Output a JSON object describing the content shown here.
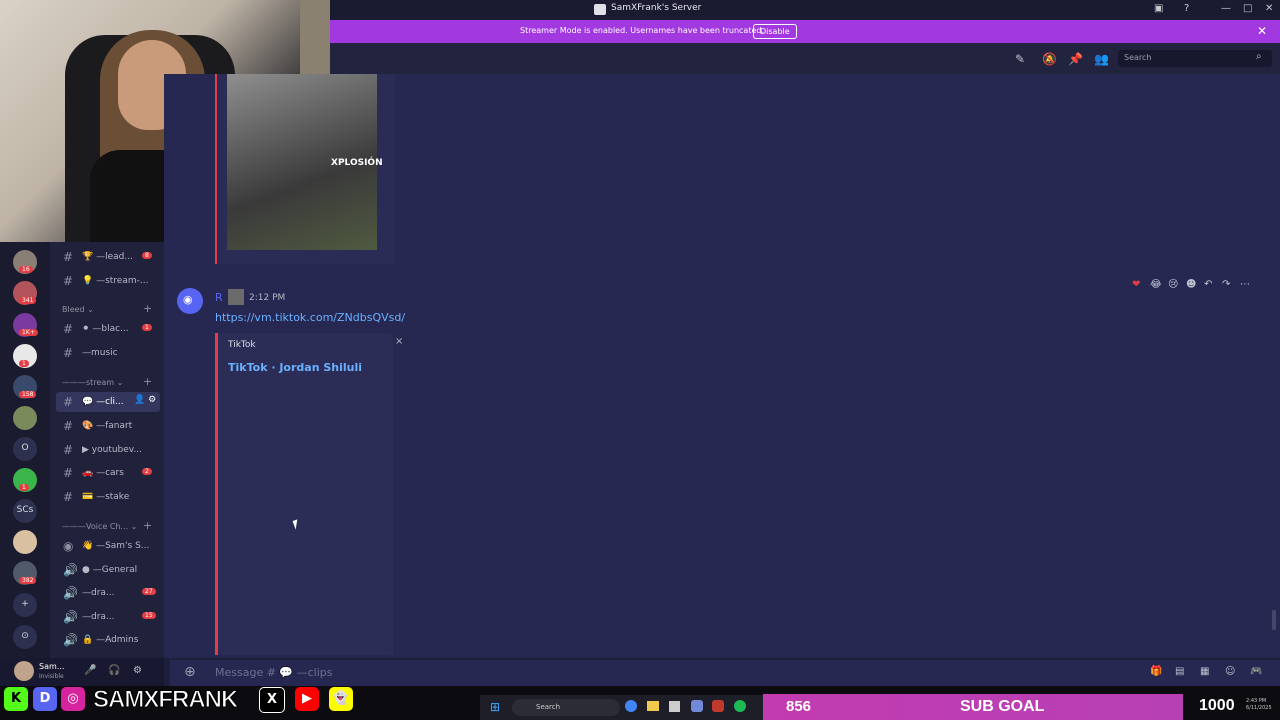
{
  "window": {
    "title": "SamXFrank's Server",
    "controls": [
      "—",
      "□",
      "✕"
    ]
  },
  "streamer_bar": {
    "message": "Streamer Mode is enabled. Usernames have been truncated.",
    "disable_label": "Disable",
    "close": "✕"
  },
  "header": {
    "search_placeholder": "Search"
  },
  "previous_embed": {
    "image_text": "XPLOSIÓN"
  },
  "servers": [
    {
      "badge": "16",
      "color": "#8a7f75"
    },
    {
      "badge": "341",
      "color": "#b3535a"
    },
    {
      "badge": "1K+",
      "color": "#7a3aa0"
    },
    {
      "badge": "1",
      "color": "#e8e8e8"
    },
    {
      "badge": "158",
      "color": "#3a4a6a"
    },
    {
      "badge": "",
      "color": "#7a8a5a"
    },
    {
      "label": "O",
      "color": "#2e3050"
    },
    {
      "badge": "1",
      "color": "#3ab54a"
    },
    {
      "label": "SCs",
      "color": "#2e3050"
    },
    {
      "badge": "",
      "color": "#d8c0a0"
    },
    {
      "badge": "382",
      "color": "#505a6a"
    },
    {
      "label": "+",
      "color": "#2e3050"
    },
    {
      "label": "⊙",
      "color": "#2e3050"
    }
  ],
  "channels": {
    "items": [
      {
        "prefix": "#",
        "emoji": "🏆",
        "name": "—lead...",
        "badge": "8"
      },
      {
        "prefix": "#",
        "emoji": "💡",
        "name": "—stream-...",
        "badge": ""
      },
      {
        "category": "Bleed"
      },
      {
        "prefix": "#",
        "emoji": "⚫",
        "name": "—blac...",
        "badge": "1"
      },
      {
        "prefix": "#",
        "emoji": "",
        "name": "—music",
        "badge": ""
      },
      {
        "category": "———stream"
      },
      {
        "prefix": "#",
        "emoji": "💬",
        "name": "—cli...",
        "badge": "",
        "active": true
      },
      {
        "prefix": "#",
        "emoji": "🎨",
        "name": "—fanart",
        "badge": ""
      },
      {
        "prefix": "#",
        "emoji": "▶",
        "name": "youtubev...",
        "badge": ""
      },
      {
        "prefix": "#",
        "emoji": "🚗",
        "name": "—cars",
        "badge": "2"
      },
      {
        "prefix": "#",
        "emoji": "💳",
        "name": "—stake",
        "badge": ""
      },
      {
        "category": "———Voice Ch..."
      },
      {
        "prefix": "◉",
        "emoji": "👋",
        "name": "—Sam's S...",
        "badge": ""
      },
      {
        "prefix": "🔊",
        "emoji": "●",
        "name": "—General",
        "badge": ""
      },
      {
        "prefix": "🔊",
        "emoji": "",
        "name": "—dra...",
        "badge": "27"
      },
      {
        "prefix": "🔊",
        "emoji": "",
        "name": "—dra...",
        "badge": "15"
      },
      {
        "prefix": "🔊",
        "emoji": "🔒",
        "name": "—Admins",
        "badge": ""
      }
    ]
  },
  "message": {
    "author_initial": "R",
    "timestamp": "2:12 PM",
    "link": "https://vm.tiktok.com/ZNdbsQVsd/",
    "embed": {
      "provider": "TikTok",
      "title": "TikTok · Jordan Shiluli",
      "close": "×"
    },
    "reactions": [
      "❤",
      "😂",
      "😢",
      "☻",
      "↶",
      "↷",
      "⋯"
    ]
  },
  "user_panel": {
    "name": "Sam...",
    "status": "Invisible"
  },
  "input": {
    "placeholder": "Message # 💬 —clips"
  },
  "overlay": {
    "brand": "SAMXFRANK",
    "social": [
      "K",
      "D",
      "◎",
      "X",
      "▶",
      "👻"
    ],
    "sub_count": "856",
    "sub_goal_label": "SUB GOAL",
    "sub_goal_total": "1000",
    "clock_time": "2:43 PM",
    "clock_date": "6/11/2025"
  },
  "taskbar": {
    "search_label": "Search"
  }
}
